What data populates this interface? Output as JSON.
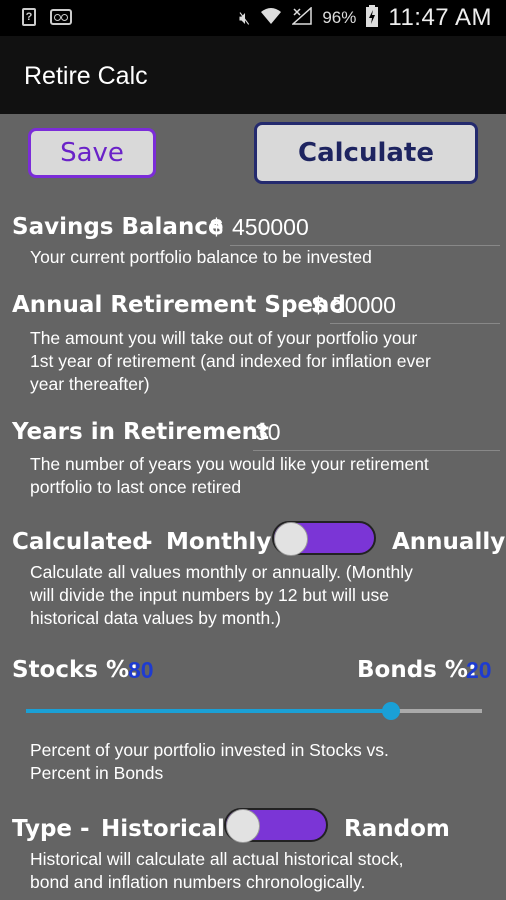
{
  "status": {
    "battery_percent": "96%",
    "time": "11:47 AM",
    "icons": [
      "sim-icon",
      "voicemail-icon",
      "mute-icon",
      "wifi-icon",
      "no-signal-icon",
      "battery-charging-icon"
    ]
  },
  "appbar": {
    "title": "Retire Calc"
  },
  "buttons": {
    "save": "Save",
    "calculate": "Calculate"
  },
  "savings": {
    "label": "Savings Balance",
    "currency": "$",
    "value": "450000",
    "desc": "Your current portfolio balance to be invested"
  },
  "spend": {
    "label": "Annual Retirement Spend",
    "currency": "$",
    "value": "50000",
    "desc_lines": [
      "The amount you will take out of your portfolio your",
      "1st year of retirement (and indexed for inflation ever",
      "year thereafter)"
    ]
  },
  "years": {
    "label": "Years in Retirement",
    "value": "30",
    "desc_lines": [
      "The number of years you would like your retirement",
      "portfolio to last once retired"
    ]
  },
  "calculated": {
    "label": "Calculated",
    "dash": "-",
    "left_option": "Monthly",
    "right_option": "Annually",
    "desc_lines": [
      "Calculate all values monthly or annually.  (Monthly",
      "will divide the input numbers by 12 but will use",
      "historical data values by month.)"
    ]
  },
  "allocation": {
    "stocks_label": "Stocks %:",
    "stocks_value": "80",
    "bonds_label": "Bonds %:",
    "bonds_value": "20",
    "stocks_fraction": 0.8,
    "desc_lines": [
      "Percent of your portfolio invested in Stocks vs.",
      "Percent in Bonds"
    ]
  },
  "type": {
    "label": "Type",
    "dash": "-",
    "left_option": "Historical",
    "right_option": "Random",
    "desc_lines": [
      "Historical will calculate all actual historical stock,",
      "bond and inflation numbers chronologically."
    ]
  },
  "colors": {
    "accent_purple": "#7b35d6",
    "slider_blue": "#1aa0d6",
    "value_blue": "#1e3bd0"
  }
}
